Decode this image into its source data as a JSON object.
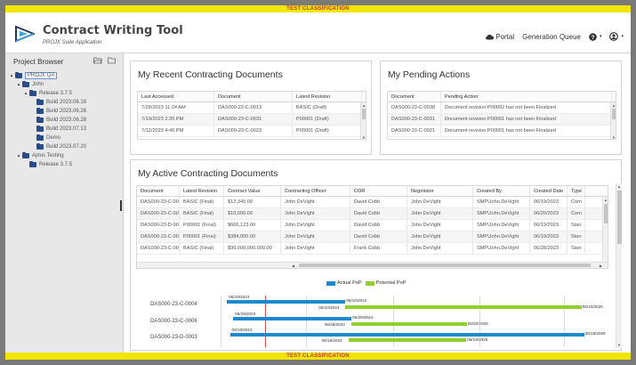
{
  "classification": "TEST CLASSIFICATION",
  "header": {
    "title": "Contract Writing Tool",
    "subtitle": "PROJX Suite Application",
    "portal_label": "Portal",
    "queue_label": "Generation Queue"
  },
  "sidebar": {
    "title": "Project Browser",
    "tree": [
      {
        "label": "PROJX QA",
        "level": 0,
        "caret": "▴",
        "selected": true
      },
      {
        "label": "John",
        "level": 1,
        "caret": "▴"
      },
      {
        "label": "Release 3.7.5",
        "level": 2,
        "caret": "▴"
      },
      {
        "label": "Build 2023.06.18",
        "level": 3
      },
      {
        "label": "Build 2023.06.26",
        "level": 3
      },
      {
        "label": "Build 2023.06.28",
        "level": 3
      },
      {
        "label": "Build 2023.07.13",
        "level": 3
      },
      {
        "label": "Demo",
        "level": 3
      },
      {
        "label": "Build 2023.07.20",
        "level": 3
      },
      {
        "label": "Aplus Testing",
        "level": 1,
        "caret": "▴"
      },
      {
        "label": "Release 3.7.5",
        "level": 2
      }
    ]
  },
  "recent": {
    "title": "My Recent Contracting Documents",
    "columns": [
      "Last Accessed",
      "Document",
      "Latest Revision"
    ],
    "rows": [
      [
        "7/28/2023 11:24 AM",
        "DAS000-23-C-0013",
        "BASIC (Draft)"
      ],
      [
        "7/19/2023 2:35 PM",
        "DAS000-23-C-0031",
        "P00001 (Draft)"
      ],
      [
        "7/12/2023 4:46 PM",
        "DAS000-23-C-0023",
        "P00001 (Draft)"
      ]
    ]
  },
  "pending": {
    "title": "My Pending Actions",
    "columns": [
      "Document",
      "Pending Action"
    ],
    "rows": [
      [
        "DAS000-23-C-0038",
        "Document revision P00002 has not been Finalized"
      ],
      [
        "DAS000-23-C-0031",
        "Document revision P00001 has not been Finalized"
      ],
      [
        "DAS000-23-C-0021",
        "Document revision P00001 has not been Finalized"
      ]
    ]
  },
  "active": {
    "title": "My Active Contracting Documents",
    "columns": [
      "Document",
      "Latest Revision",
      "Contract Value",
      "Contracting Officer",
      "COR",
      "Negotiator",
      "Created By",
      "Created Date",
      "Type"
    ],
    "rows": [
      [
        "DAS000-23-C-0004",
        "BASIC (Final)",
        "$12,345.00",
        "John DeVight",
        "David Cobb",
        "John DeVight",
        "SMP\\John.DeVight",
        "06/19/2023",
        "Com"
      ],
      [
        "DAS000-23-C-0009",
        "BASIC (Final)",
        "$10,000.00",
        "John DeVight",
        "David Cobb",
        "John DeVight",
        "SMP\\John.DeVight",
        "06/20/2023",
        "Com"
      ],
      [
        "DAS000-23-D-0003",
        "P00001 (Final)",
        "$666,123.00",
        "John DeVight",
        "David Cobb",
        "John DeVight",
        "SMP\\John.DeVight",
        "06/19/2023",
        "Stan"
      ],
      [
        "DAS000-23-C-0001",
        "P00001 (Final)",
        "$384,000.00",
        "John DeVight",
        "David Cobb",
        "John DeVight",
        "SMP\\John.DeVight",
        "06/19/2023",
        "Stan"
      ],
      [
        "DAS000-23-C-0021",
        "BASIC (Final)",
        "$99,000,000,000.00",
        "John DeVight",
        "Frank Cobb",
        "John DeVight",
        "SMP\\John.DeVight",
        "06/28/2023",
        "Stan"
      ]
    ]
  },
  "gantt": {
    "legend": {
      "actual": "Actual PoP",
      "potential": "Potential PoP"
    },
    "colors": {
      "actual": "#1f88d0",
      "potential": "#8fcf2e",
      "today": "#e04b4b"
    },
    "rows": [
      {
        "document": "DAS000-23-C-0004",
        "actual_start": "06/10/2023",
        "actual_end": "06/10/2024",
        "potential_start": "06/10/2024",
        "potential_end": "06/10/2026"
      },
      {
        "document": "DAS000-23-C-0006",
        "actual_start": "06/29/2023",
        "actual_end": "06/29/2024",
        "potential_start": "06/28/2024",
        "potential_end": "06/20/2025"
      },
      {
        "document": "DAS000-23-D-0003",
        "actual_start": "06/19/2023",
        "actual_end": "06/18/2026",
        "potential_start": "06/19/2024",
        "potential_end": "06/19/2025"
      }
    ]
  }
}
